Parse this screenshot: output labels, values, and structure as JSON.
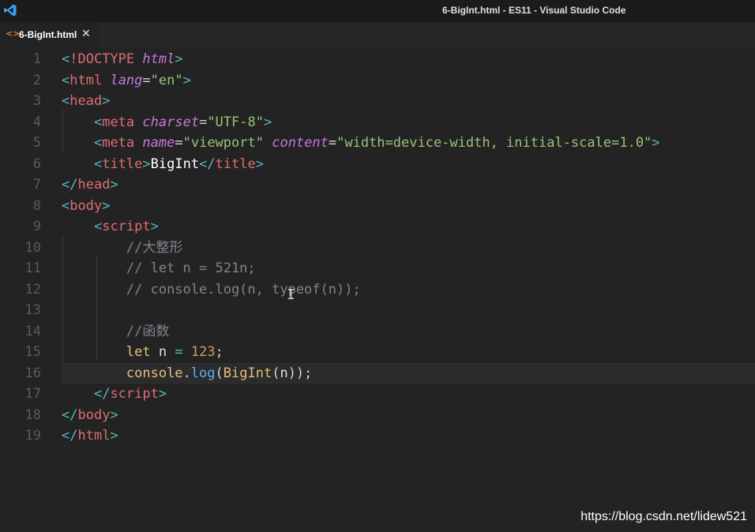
{
  "window": {
    "title": "6-BigInt.html - ES11 - Visual Studio Code"
  },
  "tab": {
    "icon": "html-file-icon",
    "label": "6-BigInt.html",
    "close_glyph": "✕"
  },
  "editor": {
    "current_line": 16,
    "lines": [
      {
        "n": "1",
        "tokens": [
          [
            "br",
            "<"
          ],
          [
            "tag",
            "!DOCTYPE"
          ],
          [
            "def",
            " "
          ],
          [
            "attr",
            "html"
          ],
          [
            "br",
            ">"
          ]
        ]
      },
      {
        "n": "2",
        "tokens": [
          [
            "br",
            "<"
          ],
          [
            "tag",
            "html"
          ],
          [
            "def",
            " "
          ],
          [
            "attr",
            "lang"
          ],
          [
            "punc",
            "="
          ],
          [
            "str",
            "\"en\""
          ],
          [
            "br",
            ">"
          ]
        ]
      },
      {
        "n": "3",
        "tokens": [
          [
            "br",
            "<"
          ],
          [
            "tag",
            "head"
          ],
          [
            "br",
            ">"
          ]
        ]
      },
      {
        "n": "4",
        "tokens": [
          [
            "def",
            "    "
          ],
          [
            "br",
            "<"
          ],
          [
            "tag",
            "meta"
          ],
          [
            "def",
            " "
          ],
          [
            "attr",
            "charset"
          ],
          [
            "punc",
            "="
          ],
          [
            "str",
            "\"UTF-8\""
          ],
          [
            "br",
            ">"
          ]
        ]
      },
      {
        "n": "5",
        "tokens": [
          [
            "def",
            "    "
          ],
          [
            "br",
            "<"
          ],
          [
            "tag",
            "meta"
          ],
          [
            "def",
            " "
          ],
          [
            "attr",
            "name"
          ],
          [
            "punc",
            "="
          ],
          [
            "str",
            "\"viewport\""
          ],
          [
            "def",
            " "
          ],
          [
            "attr",
            "content"
          ],
          [
            "punc",
            "="
          ],
          [
            "str",
            "\"width=device-width, initial-scale=1.0\""
          ],
          [
            "br",
            ">"
          ]
        ]
      },
      {
        "n": "6",
        "tokens": [
          [
            "def",
            "    "
          ],
          [
            "br",
            "<"
          ],
          [
            "tag",
            "title"
          ],
          [
            "br",
            ">"
          ],
          [
            "text",
            "BigInt"
          ],
          [
            "br",
            "</"
          ],
          [
            "tag",
            "title"
          ],
          [
            "br",
            ">"
          ]
        ]
      },
      {
        "n": "7",
        "tokens": [
          [
            "br",
            "</"
          ],
          [
            "tag",
            "head"
          ],
          [
            "br",
            ">"
          ]
        ]
      },
      {
        "n": "8",
        "tokens": [
          [
            "br",
            "<"
          ],
          [
            "tag",
            "body"
          ],
          [
            "br",
            ">"
          ]
        ]
      },
      {
        "n": "9",
        "tokens": [
          [
            "def",
            "    "
          ],
          [
            "br",
            "<"
          ],
          [
            "tag",
            "script"
          ],
          [
            "br",
            ">"
          ]
        ]
      },
      {
        "n": "10",
        "tokens": [
          [
            "def",
            "        "
          ],
          [
            "com",
            "//大整形"
          ]
        ]
      },
      {
        "n": "11",
        "tokens": [
          [
            "def",
            "        "
          ],
          [
            "com",
            "// let n = 521n;"
          ]
        ]
      },
      {
        "n": "12",
        "tokens": [
          [
            "def",
            "        "
          ],
          [
            "com",
            "// console.log(n, typeof(n));"
          ]
        ]
      },
      {
        "n": "13",
        "tokens": []
      },
      {
        "n": "14",
        "tokens": [
          [
            "def",
            "        "
          ],
          [
            "com",
            "//函数"
          ]
        ]
      },
      {
        "n": "15",
        "tokens": [
          [
            "def",
            "        "
          ],
          [
            "kw",
            "let"
          ],
          [
            "def",
            " n "
          ],
          [
            "op",
            "="
          ],
          [
            "def",
            " "
          ],
          [
            "num",
            "123"
          ],
          [
            "punc",
            ";"
          ]
        ]
      },
      {
        "n": "16",
        "tokens": [
          [
            "def",
            "        "
          ],
          [
            "kw",
            "console"
          ],
          [
            "punc",
            "."
          ],
          [
            "fn",
            "log"
          ],
          [
            "punc",
            "("
          ],
          [
            "kw",
            "BigInt"
          ],
          [
            "punc",
            "("
          ],
          [
            "def",
            "n"
          ],
          [
            "punc",
            "));"
          ]
        ]
      },
      {
        "n": "17",
        "tokens": [
          [
            "def",
            "    "
          ],
          [
            "br",
            "</"
          ],
          [
            "tag",
            "script"
          ],
          [
            "br",
            ">"
          ]
        ]
      },
      {
        "n": "18",
        "tokens": [
          [
            "br",
            "</"
          ],
          [
            "tag",
            "body"
          ],
          [
            "br",
            ">"
          ]
        ]
      },
      {
        "n": "19",
        "tokens": [
          [
            "br",
            "</"
          ],
          [
            "tag",
            "html"
          ],
          [
            "br",
            ">"
          ]
        ]
      }
    ]
  },
  "mouse_cursor": "I",
  "watermark": "https://blog.csdn.net/lidew521",
  "colors": {
    "background": "#232323",
    "tag": "#e06c75",
    "bracket": "#56b6c2",
    "attribute": "#c678dd",
    "string": "#98c379",
    "comment": "#7f848e",
    "keyword": "#e5c07b",
    "function": "#61afef",
    "number": "#d19a66"
  }
}
